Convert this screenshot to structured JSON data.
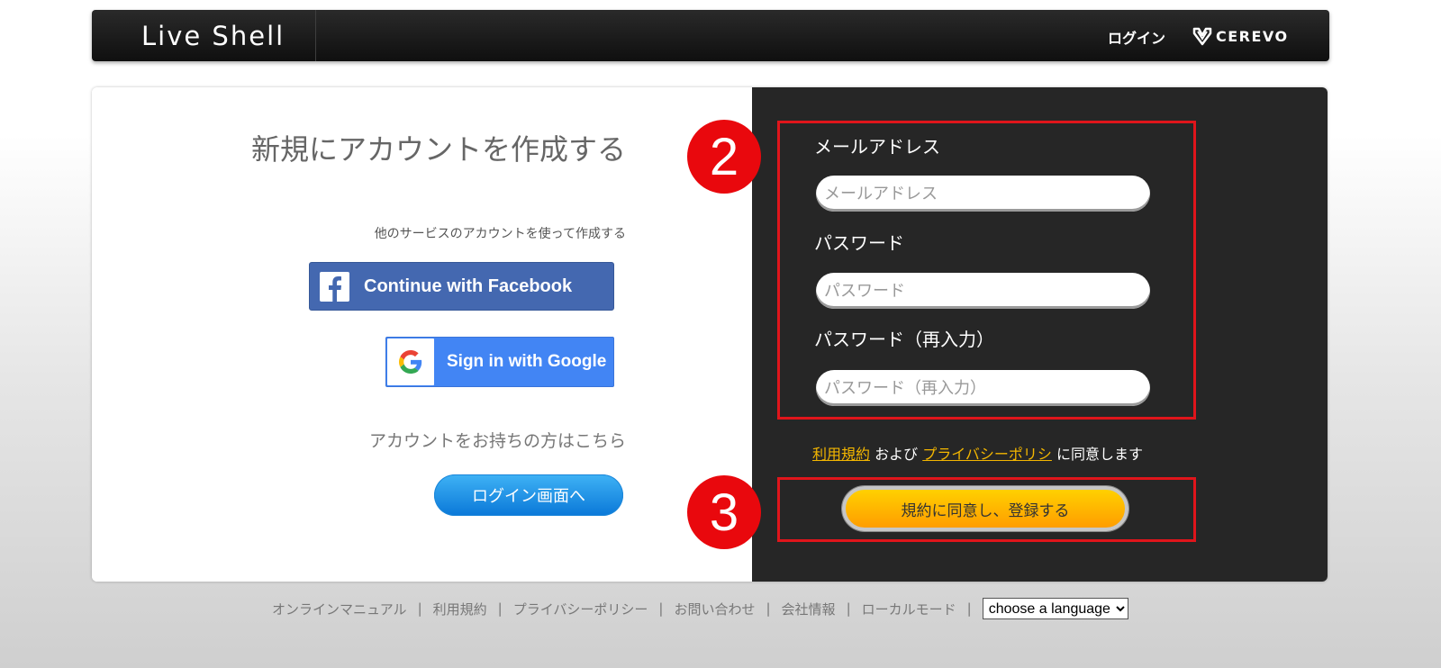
{
  "header": {
    "logo": "Live Shell",
    "login_link": "ログイン",
    "brand": "CEREVO"
  },
  "left": {
    "title": "新規にアカウントを作成する",
    "other_services": "他のサービスのアカウントを使って作成する",
    "facebook_button": "Continue with Facebook",
    "google_button": "Sign in with Google",
    "has_account": "アカウントをお持ちの方はこちら",
    "login_button": "ログイン画面へ"
  },
  "form": {
    "email_label": "メールアドレス",
    "email_placeholder": "メールアドレス",
    "password_label": "パスワード",
    "password_placeholder": "パスワード",
    "password_confirm_label": "パスワード（再入力）",
    "password_confirm_placeholder": "パスワード（再入力）",
    "terms_link": "利用規約",
    "and_text": "および",
    "privacy_link": "プライバシーポリシ",
    "agree_text": "に同意します",
    "submit_button": "規約に同意し、登録する"
  },
  "annotations": {
    "step2": "2",
    "step3": "3"
  },
  "footer": {
    "links": [
      "オンラインマニュアル",
      "利用規約",
      "プライバシーポリシー",
      "お問い合わせ",
      "会社情報",
      "ローカルモード"
    ],
    "language_select": "choose a language"
  },
  "colors": {
    "header_bg": "#1a1a1a",
    "panel_dark": "#262626",
    "facebook_blue": "#4468b0",
    "google_blue": "#4285f4",
    "link_yellow": "#f3b600",
    "submit_orange": "#ffb300",
    "annotation_red": "#e0151b"
  }
}
